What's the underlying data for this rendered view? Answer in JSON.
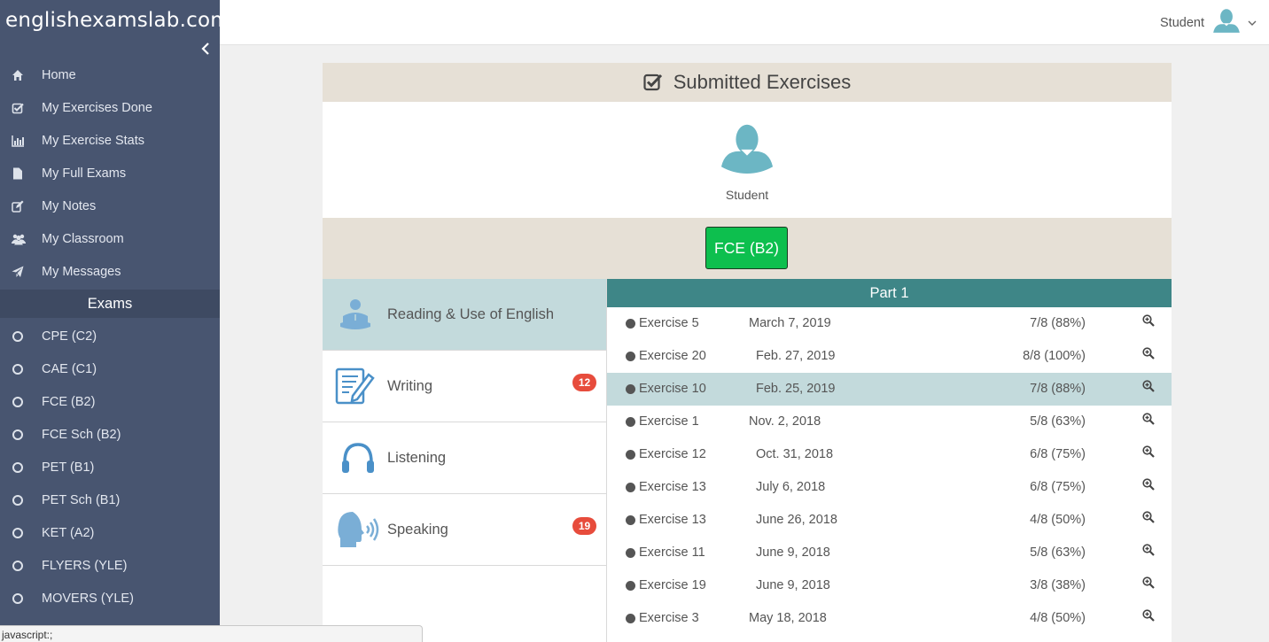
{
  "sidebar": {
    "logo": "englishexamslab.com",
    "collapse_icon": "chevron-left-icon",
    "items": [
      {
        "label": "Home",
        "icon": "home-icon"
      },
      {
        "label": "My Exercises Done",
        "icon": "check-square-icon"
      },
      {
        "label": "My Exercise Stats",
        "icon": "bar-chart-icon"
      },
      {
        "label": "My Full Exams",
        "icon": "file-icon"
      },
      {
        "label": "My Notes",
        "icon": "edit-icon"
      },
      {
        "label": "My Classroom",
        "icon": "users-icon"
      },
      {
        "label": "My Messages",
        "icon": "send-icon"
      }
    ],
    "section_title": "Exams",
    "exams": [
      {
        "label": "CPE (C2)"
      },
      {
        "label": "CAE (C1)"
      },
      {
        "label": "FCE (B2)"
      },
      {
        "label": "FCE Sch (B2)"
      },
      {
        "label": "PET (B1)"
      },
      {
        "label": "PET Sch (B1)"
      },
      {
        "label": "KET (A2)"
      },
      {
        "label": "FLYERS (YLE)"
      },
      {
        "label": "MOVERS (YLE)"
      }
    ]
  },
  "topbar": {
    "user_name": "Student",
    "dropdown_icon": "chevron-down-icon"
  },
  "main": {
    "title": "Submitted Exercises",
    "profile_name": "Student",
    "exam_button": "FCE (B2)",
    "exam_button_color": "#0dbf4e",
    "papers": [
      {
        "label": "Reading & Use of English",
        "icon": "reader-icon",
        "badge": "",
        "active": true
      },
      {
        "label": "Writing",
        "icon": "writing-icon",
        "badge": "12",
        "active": false
      },
      {
        "label": "Listening",
        "icon": "headphones-icon",
        "badge": "",
        "active": false
      },
      {
        "label": "Speaking",
        "icon": "speaking-icon",
        "badge": "19",
        "active": false
      }
    ],
    "part_title": "Part 1",
    "exercises": [
      {
        "name": "Exercise 5",
        "date": "March 7, 2019",
        "score": "7/8 (88%)"
      },
      {
        "name": "Exercise 20",
        "date": "Feb. 27, 2019",
        "score": "8/8 (100%)"
      },
      {
        "name": "Exercise 10",
        "date": "Feb. 25, 2019",
        "score": "7/8 (88%)"
      },
      {
        "name": "Exercise 1",
        "date": "Nov. 2, 2018",
        "score": "5/8 (63%)"
      },
      {
        "name": "Exercise 12",
        "date": "Oct. 31, 2018",
        "score": "6/8 (75%)"
      },
      {
        "name": "Exercise 13",
        "date": "July 6, 2018",
        "score": "6/8 (75%)"
      },
      {
        "name": "Exercise 13",
        "date": "June 26, 2018",
        "score": "4/8 (50%)"
      },
      {
        "name": "Exercise 11",
        "date": "June 9, 2018",
        "score": "5/8 (63%)"
      },
      {
        "name": "Exercise 19",
        "date": "June 9, 2018",
        "score": "3/8 (38%)"
      },
      {
        "name": "Exercise 3",
        "date": "May 18, 2018",
        "score": "4/8 (50%)"
      }
    ],
    "highlighted_row": 3
  },
  "status_bar": "javascript:;",
  "colors": {
    "sidebar_bg": "#485570",
    "header_band": "#e6e0d6",
    "part_header": "#3e8687",
    "highlight": "#c3dadc",
    "badge": "#e74c3c",
    "avatar": "#6cb6c4"
  }
}
